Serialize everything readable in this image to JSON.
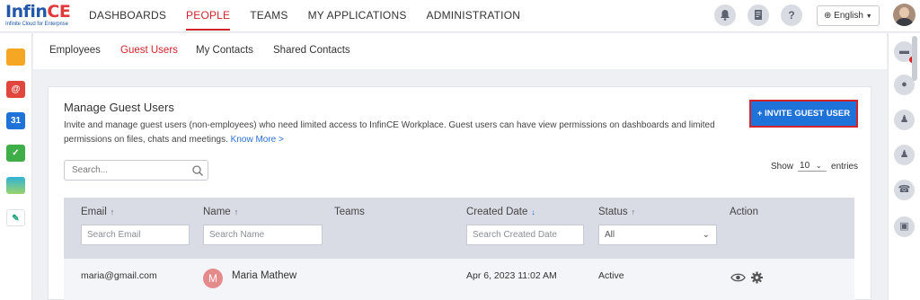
{
  "brand": {
    "logo_main": "Infin",
    "logo_accent": "CE",
    "tagline": "Infinite Cloud for Enterprise"
  },
  "nav": {
    "items": [
      "DASHBOARDS",
      "PEOPLE",
      "TEAMS",
      "MY APPLICATIONS",
      "ADMINISTRATION"
    ],
    "active": "PEOPLE"
  },
  "topbar": {
    "language_label": "English",
    "icons": [
      "bell-icon",
      "document-icon",
      "help-icon",
      "globe-icon",
      "chevron-down-icon"
    ]
  },
  "left_apps": [
    {
      "name": "folder-app-icon",
      "color": "#f5a623",
      "glyph": ""
    },
    {
      "name": "mail-app-icon",
      "color": "#e0463e",
      "glyph": "@"
    },
    {
      "name": "calendar-app-icon",
      "color": "#1f73d8",
      "glyph": "31"
    },
    {
      "name": "tasks-app-icon",
      "color": "#3fae49",
      "glyph": "✓"
    },
    {
      "name": "gallery-app-icon",
      "color": "#2fb3d5",
      "glyph": ""
    },
    {
      "name": "signature-app-icon",
      "color": "#ffffff",
      "glyph": "✎"
    }
  ],
  "right_rail": [
    "chat-icon",
    "person-icon",
    "user-settings-icon",
    "contacts-icon",
    "phone-icon",
    "calendar-check-icon"
  ],
  "subtabs": {
    "items": [
      "Employees",
      "Guest Users",
      "My Contacts",
      "Shared Contacts"
    ],
    "active": "Guest Users"
  },
  "card": {
    "title": "Manage Guest Users",
    "description": "Invite and manage guest users (non-employees) who need limited access to InfinCE Workplace. Guest users can have view permissions on dashboards and limited permissions on files, chats and meetings.",
    "know_more": "Know More >",
    "invite_button": "+ INVITE GUEST USER",
    "search_placeholder": "Search...",
    "show_label": "Show",
    "show_value": "10",
    "entries_label": "entries"
  },
  "table": {
    "columns": [
      {
        "label": "Email",
        "sort": "↑",
        "filter_placeholder": "Search Email"
      },
      {
        "label": "Name",
        "sort": "↑",
        "filter_placeholder": "Search Name"
      },
      {
        "label": "Teams",
        "sort": "",
        "filter_placeholder": ""
      },
      {
        "label": "Created Date",
        "sort": "↓",
        "filter_placeholder": "Search Created Date"
      },
      {
        "label": "Status",
        "sort": "↑",
        "filter_value": "All"
      },
      {
        "label": "Action",
        "sort": ""
      }
    ],
    "rows": [
      {
        "email": "maria@gmail.com",
        "avatar_initial": "M",
        "name": "Maria Mathew",
        "teams": "",
        "created": "Apr 6, 2023 11:02 AM",
        "status": "Active",
        "actions": [
          "view-icon",
          "settings-icon"
        ]
      }
    ]
  },
  "colors": {
    "brand_red": "#d2232a",
    "primary_blue": "#1f73d8",
    "header_gray": "#d9dce5"
  }
}
